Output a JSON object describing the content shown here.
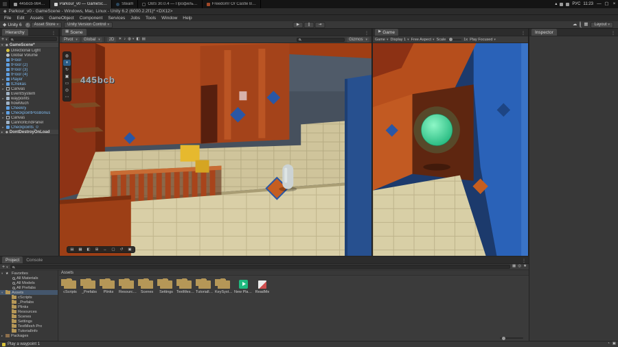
{
  "taskbar": {
    "window_tabs": [
      {
        "label": "445bcb-984…"
      },
      {
        "label": "Parkour_v0 — GameSc…",
        "active": true
      },
      {
        "label": "Steam"
      },
      {
        "label": "OBS 30.0.4 — Профиль…"
      },
      {
        "label": "Freedom! Or Castle B…"
      }
    ],
    "tray": {
      "language": "РУС",
      "time": "11:23"
    }
  },
  "titlebar": {
    "title": "Parkour_v0 - GameScene - Windows, Mac, Linux - Unity 6.2 (6000.2.2f1)* <DX12>"
  },
  "menubar": {
    "items": [
      {
        "label": "File"
      },
      {
        "label": "Edit"
      },
      {
        "label": "Assets"
      },
      {
        "label": "GameObject"
      },
      {
        "label": "Component"
      },
      {
        "label": "Services"
      },
      {
        "label": "Jobs"
      },
      {
        "label": "Tools"
      },
      {
        "label": "Window"
      },
      {
        "label": "Help"
      }
    ]
  },
  "toolbar": {
    "brand": "Unity 6",
    "asset_store_label": "Asset Store",
    "version_control_label": "Unity Version Control",
    "layout_label": "Layout",
    "transport": {
      "play": "▶",
      "pause": "∥",
      "step": "⇥"
    }
  },
  "hierarchy": {
    "tab_label": "Hierarchy",
    "scene_header": "GameScene*",
    "extra_scene_header": "DontDestroyOnLoad",
    "items": [
      {
        "name": "Directional Light",
        "icon": "light"
      },
      {
        "name": "Global Volume",
        "icon": "volume"
      },
      {
        "name": "tFloor",
        "icon": "prefab",
        "kind": "prefab"
      },
      {
        "name": "tFloor (2)",
        "icon": "prefab",
        "kind": "prefab"
      },
      {
        "name": "tFloor (3)",
        "icon": "prefab",
        "kind": "prefab"
      },
      {
        "name": "tFloor (4)",
        "icon": "prefab",
        "kind": "prefab"
      },
      {
        "name": "Player",
        "icon": "prefab",
        "kind": "prefab",
        "arrow": "▸"
      },
      {
        "name": "tChekas",
        "icon": "prefab",
        "kind": "prefab",
        "arrow": "▸"
      },
      {
        "name": "Canvas",
        "icon": "canvas",
        "arrow": "▸"
      },
      {
        "name": "EventSystem",
        "icon": "cube"
      },
      {
        "name": "waypoints",
        "icon": "cube",
        "arrow": "▸"
      },
      {
        "name": "howMuch",
        "icon": "cube"
      },
      {
        "name": "Cheekry",
        "icon": "prefab",
        "kind": "prefab"
      },
      {
        "name": "CheckpointPosBonus",
        "icon": "prefab",
        "kind": "prefab",
        "arrow": "▸"
      },
      {
        "name": "Canvas",
        "icon": "canvas",
        "arrow": "▸"
      },
      {
        "name": "CannonEndPanel",
        "icon": "cube"
      },
      {
        "name": "Checkpoints_0",
        "icon": "prefab",
        "kind": "prefab",
        "arrow": "▸"
      }
    ]
  },
  "scene": {
    "tab_label": "Scene",
    "floating_text": "445bcb",
    "toolbar": {
      "pivot": "Pivot",
      "global": "Global",
      "two_d": "2D",
      "gizmos": "Gizmos"
    },
    "tools": [
      {
        "name": "view-tool",
        "glyph": "◍"
      },
      {
        "name": "move-tool",
        "glyph": "+",
        "active": true
      },
      {
        "name": "rotate-tool",
        "glyph": "↻"
      },
      {
        "name": "scale-tool",
        "glyph": "▣"
      },
      {
        "name": "rect-tool",
        "glyph": "▭"
      },
      {
        "name": "transform-tool",
        "glyph": "◎"
      },
      {
        "name": "more-tools",
        "glyph": "⋯"
      }
    ],
    "overlay_buttons": [
      {
        "name": "camera-settings",
        "glyph": "▤"
      },
      {
        "name": "grid-toggle",
        "glyph": "▦"
      },
      {
        "name": "view-options",
        "glyph": "◧"
      },
      {
        "name": "snap-settings",
        "glyph": "⊞"
      },
      {
        "name": "move-snap",
        "glyph": "↔"
      },
      {
        "name": "frame-selected",
        "glyph": "▢"
      },
      {
        "name": "orientation",
        "glyph": "↺"
      },
      {
        "name": "overlay-menu",
        "glyph": "▣"
      }
    ]
  },
  "game": {
    "tab_label": "Game",
    "toolbar": {
      "mode": "Game",
      "display": "Display 1",
      "aspect": "Free Aspect",
      "scale_label": "Scale",
      "scale_value": "1x",
      "focus": "Play Focused"
    }
  },
  "inspector": {
    "tab_label": "Inspector"
  },
  "project": {
    "tab_label": "Project",
    "console_tab_label": "Console",
    "breadcrumb": "Assets",
    "tree": [
      {
        "label": "Favorites",
        "icon": "star",
        "arrow": "▾",
        "indent": 0
      },
      {
        "label": "All Materials",
        "icon": "search",
        "indent": 1
      },
      {
        "label": "All Models",
        "icon": "search",
        "indent": 1
      },
      {
        "label": "All Prefabs",
        "icon": "search",
        "indent": 1
      },
      {
        "label": "Assets",
        "icon": "folder",
        "arrow": "▾",
        "indent": 0,
        "selected": true
      },
      {
        "label": "cScripts",
        "icon": "folder",
        "indent": 1
      },
      {
        "label": "_Prefabs",
        "icon": "folder",
        "indent": 1
      },
      {
        "label": "Plinks",
        "icon": "folder",
        "indent": 1
      },
      {
        "label": "Resources",
        "icon": "folder",
        "indent": 1
      },
      {
        "label": "Scenes",
        "icon": "folder",
        "indent": 1
      },
      {
        "label": "Settings",
        "icon": "folder",
        "indent": 1
      },
      {
        "label": "TextMesh Pro",
        "icon": "folder",
        "indent": 1
      },
      {
        "label": "TutorialInfo",
        "icon": "folder",
        "indent": 1
      },
      {
        "label": "Packages",
        "icon": "package",
        "arrow": "▸",
        "indent": 0
      }
    ],
    "grid": [
      {
        "label": "cScripts",
        "icon": "folder"
      },
      {
        "label": "_Prefabs",
        "icon": "folder"
      },
      {
        "label": "Plinks",
        "icon": "folder"
      },
      {
        "label": "Resources",
        "icon": "folder"
      },
      {
        "label": "Scenes",
        "icon": "folder"
      },
      {
        "label": "Settings",
        "icon": "folder"
      },
      {
        "label": "TextMes…",
        "icon": "folder"
      },
      {
        "label": "TutorialIn…",
        "icon": "folder"
      },
      {
        "label": "KeySyste…",
        "icon": "folder"
      },
      {
        "label": "New Play…",
        "icon": "asset-green"
      },
      {
        "label": "ReadMe",
        "icon": "asset-cube"
      }
    ]
  },
  "statusbar": {
    "message": "Play a waypoint 1"
  },
  "colors": {
    "selection_blue": "#2c5d87",
    "prefab_label": "#7fb8ec",
    "folder": "#b59757",
    "orange_wall": "#b24c1e",
    "blue_accent": "#2a62b8",
    "green_orb": "#1db47a",
    "floor_tan": "#d9cfa7"
  }
}
